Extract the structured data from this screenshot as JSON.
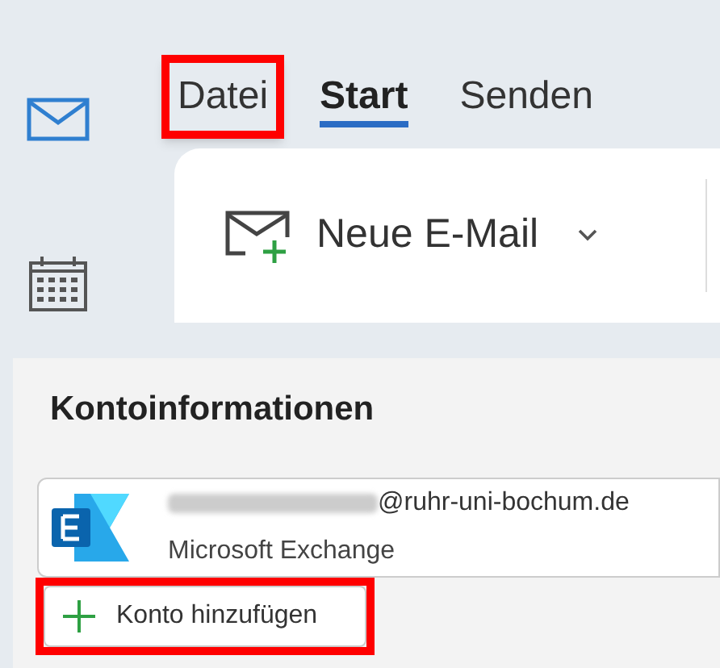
{
  "nav_rail": {
    "items": [
      {
        "kind": "mail",
        "selected": true
      },
      {
        "kind": "calendar",
        "selected": false
      }
    ]
  },
  "tabs": [
    {
      "label": "Datei",
      "selected": false,
      "highlighted": true
    },
    {
      "label": "Start",
      "selected": true,
      "highlighted": false
    },
    {
      "label": "Senden",
      "selected": false,
      "highlighted": false
    }
  ],
  "ribbon": {
    "new_mail_button": {
      "label": "Neue E-Mail"
    }
  },
  "account_info": {
    "title": "Kontoinformationen",
    "account": {
      "email": "@ruhr-uni-bochum.de",
      "type": "Microsoft Exchange"
    },
    "add_account_button": {
      "label": "Konto hinzufügen",
      "highlighted": true
    }
  }
}
